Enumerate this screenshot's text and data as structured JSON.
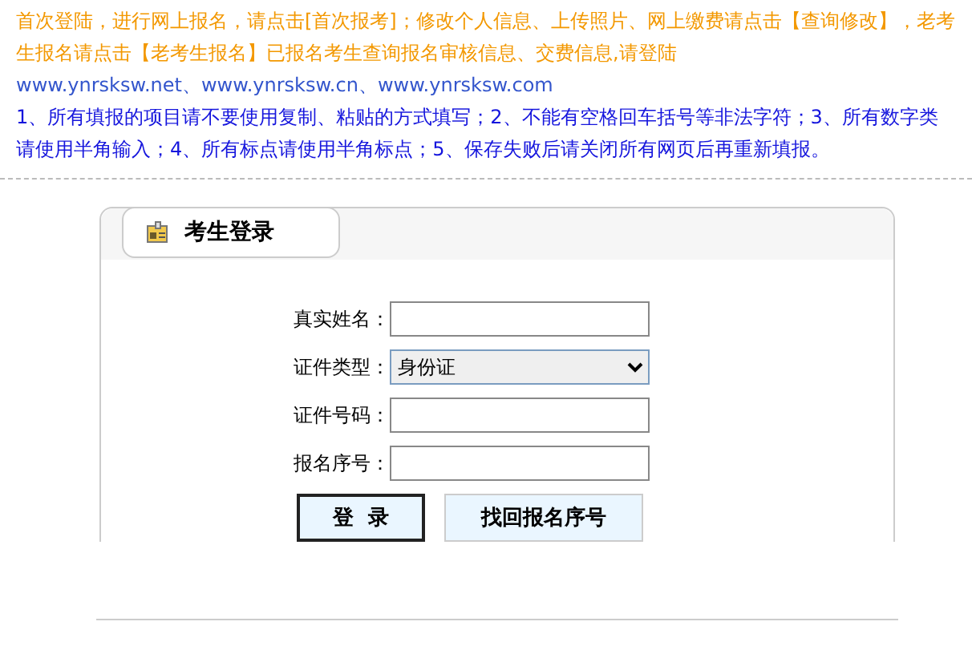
{
  "notice": {
    "instructions": "首次登陆，进行网上报名，请点击[首次报考]；修改个人信息、上传照片、网上缴费请点击【查询修改】，老考生报名请点击【老考生报名】已报名考生查询报名审核信息、交费信息,请登陆",
    "sites": "www.ynrsksw.net、www.ynrsksw.cn、www.ynrsksw.com",
    "rules": "1、所有填报的项目请不要使用复制、粘贴的方式填写；2、不能有空格回车括号等非法字符；3、所有数字类请使用半角输入；4、所有标点请使用半角标点；5、保存失败后请关闭所有网页后再重新填报。"
  },
  "login": {
    "title": "考生登录",
    "fields": [
      {
        "kind": "text",
        "label": "真实姓名："
      },
      {
        "kind": "select",
        "label": "证件类型：",
        "value": "身份证"
      },
      {
        "kind": "text",
        "label": "证件号码："
      },
      {
        "kind": "text",
        "label": "报名序号："
      }
    ],
    "buttons": [
      {
        "label": "登  录",
        "kind": "primary"
      },
      {
        "label": "找回报名序号",
        "kind": "secondary"
      }
    ]
  }
}
